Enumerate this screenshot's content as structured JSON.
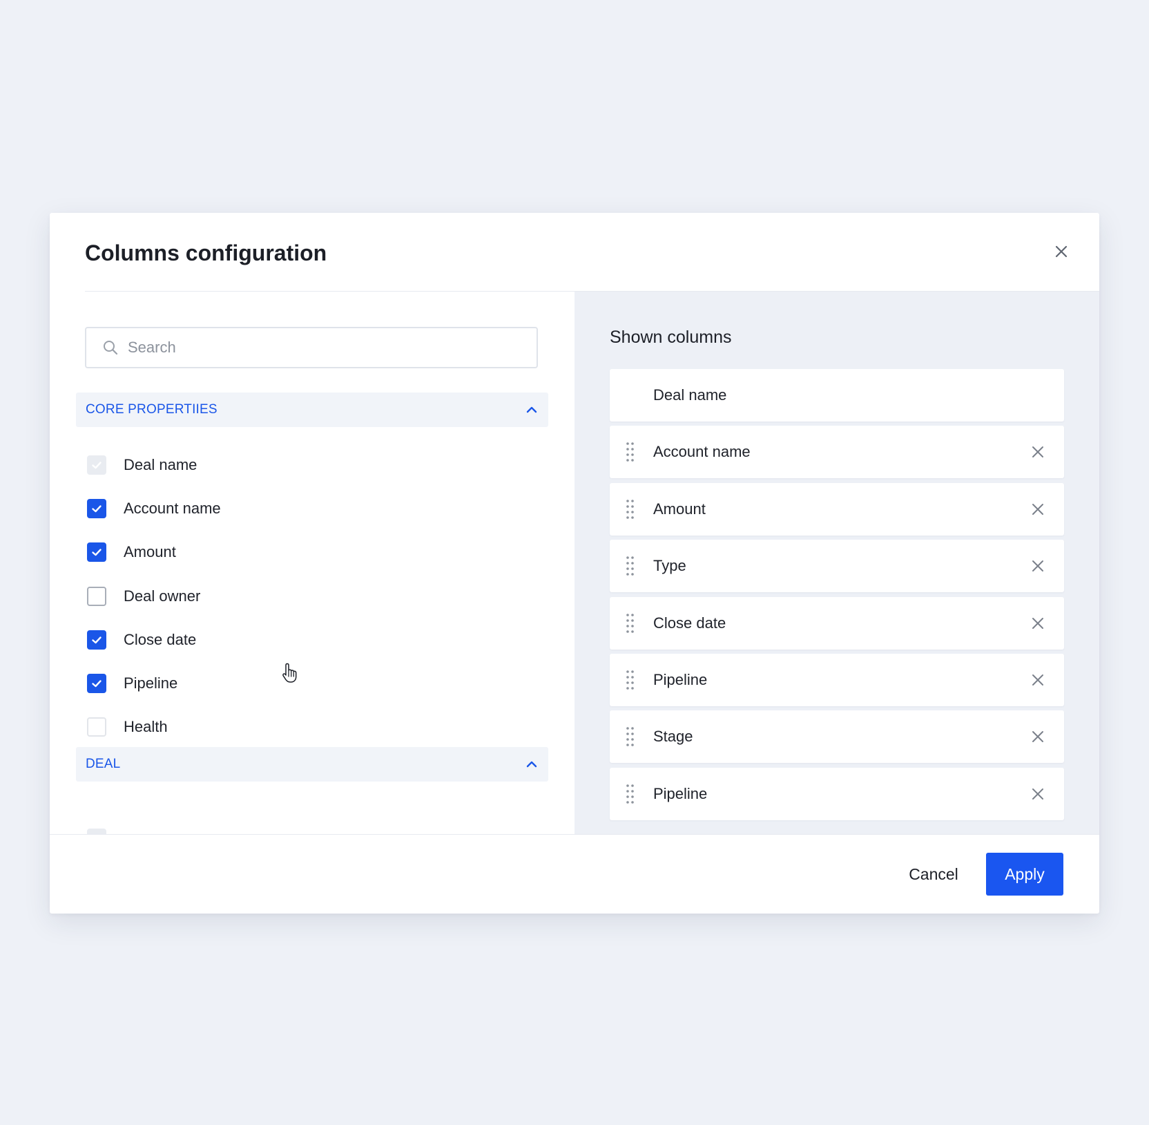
{
  "modal": {
    "title": "Columns configuration"
  },
  "search": {
    "placeholder": "Search",
    "value": ""
  },
  "sections": [
    {
      "title": "CORE PROPERTIIES",
      "expanded": true,
      "items": [
        {
          "label": "Deal name",
          "state": "checked-disabled"
        },
        {
          "label": "Account name",
          "state": "checked"
        },
        {
          "label": "Amount",
          "state": "checked"
        },
        {
          "label": "Deal owner",
          "state": "unchecked"
        },
        {
          "label": "Close date",
          "state": "checked"
        },
        {
          "label": "Pipeline",
          "state": "checked"
        },
        {
          "label": "Health",
          "state": "unchecked"
        }
      ]
    },
    {
      "title": "DEAL",
      "expanded": true
    }
  ],
  "shown": {
    "title": "Shown columns",
    "items": [
      {
        "label": "Deal name",
        "removable": false
      },
      {
        "label": "Account name",
        "removable": true
      },
      {
        "label": "Amount",
        "removable": true
      },
      {
        "label": "Type",
        "removable": true
      },
      {
        "label": "Close date",
        "removable": true
      },
      {
        "label": "Pipeline",
        "removable": true
      },
      {
        "label": "Stage",
        "removable": true
      },
      {
        "label": "Pipeline",
        "removable": true
      }
    ]
  },
  "footer": {
    "cancel_label": "Cancel",
    "apply_label": "Apply"
  },
  "colors": {
    "accent": "#1a56e8",
    "background": "#eef1f7",
    "panel": "#edf0f6"
  },
  "icons": {
    "close": "close-icon",
    "search": "search-icon",
    "chevron": "chevron-up-icon",
    "check": "checkmark-icon",
    "drag": "drag-handle-icon",
    "remove": "remove-icon",
    "cursor": "hand-cursor-icon"
  }
}
